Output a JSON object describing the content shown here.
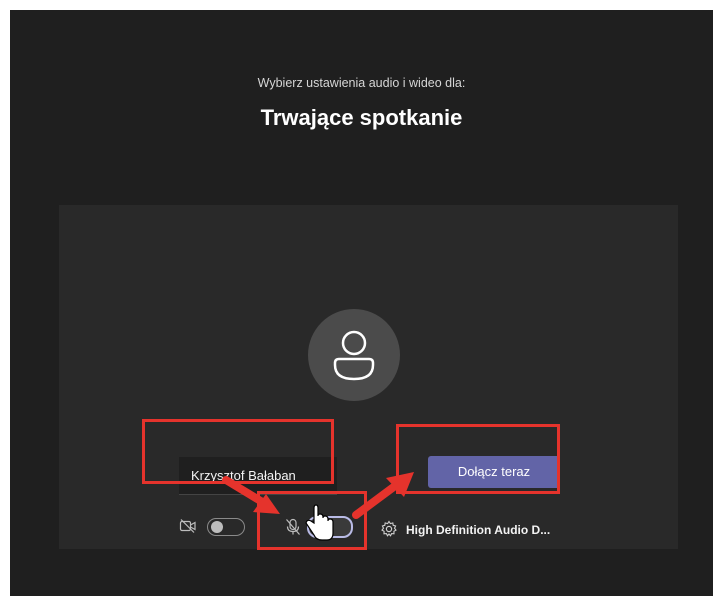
{
  "prejoin": {
    "subtitle": "Wybierz ustawienia audio i wideo dla:",
    "meeting_title": "Trwające spotkanie"
  },
  "user": {
    "display_name": "Krzysztof Bałaban"
  },
  "actions": {
    "join_label": "Dołącz teraz"
  },
  "controls": {
    "camera_toggle": "off",
    "mic_toggle": "off",
    "audio_device_label": "High Definition Audio D..."
  },
  "colors": {
    "app_background": "#1f1f1f",
    "panel_background": "#292929",
    "accent": "#6264a7",
    "highlight": "#e5332c"
  },
  "icons": [
    "person-icon",
    "camera-off-icon",
    "mic-off-icon",
    "gear-icon",
    "pointer-hand-icon",
    "arrow-icon"
  ]
}
